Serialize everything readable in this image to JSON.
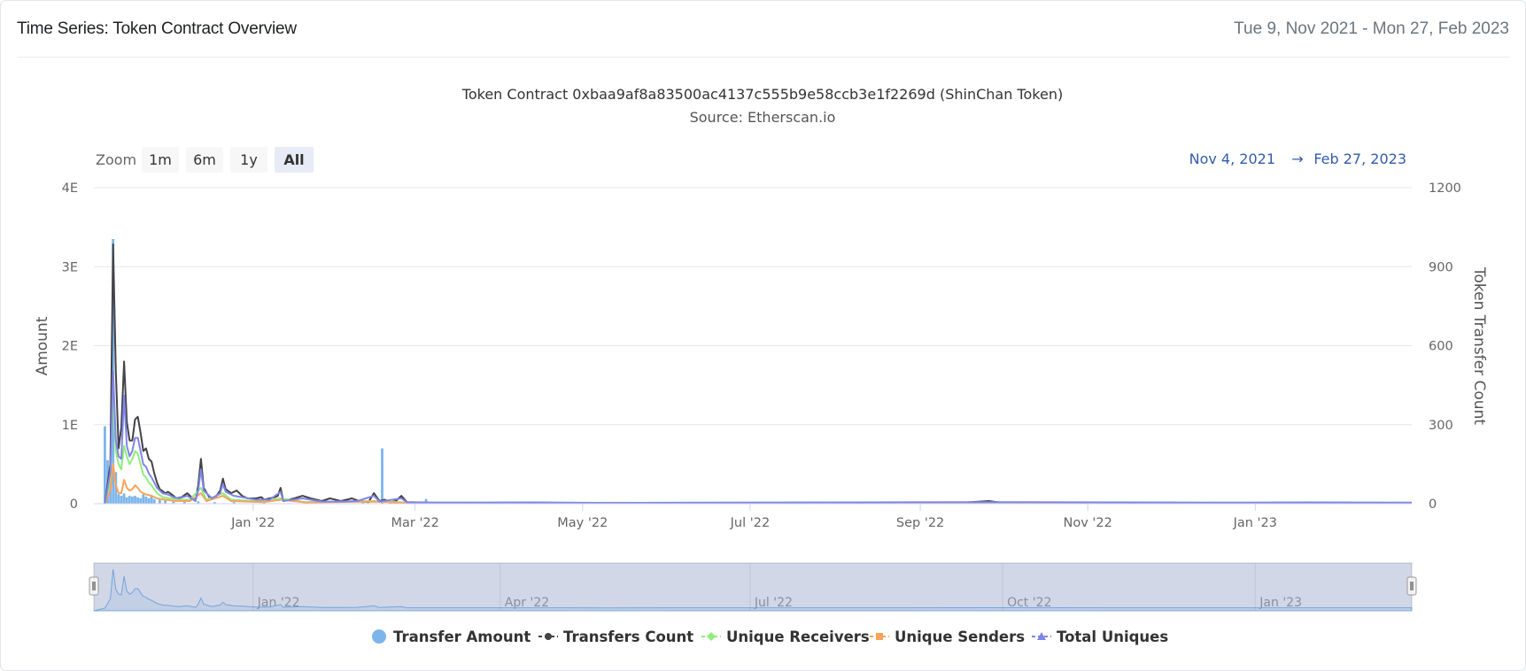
{
  "card": {
    "title": "Time Series: Token Contract Overview",
    "date_range": "Tue 9, Nov 2021 - Mon 27, Feb 2023"
  },
  "chart_data": {
    "type": "line",
    "title": "Token Contract 0xbaa9af8a83500ac4137c555b9e58ccb3e1f2269d (ShinChan Token)",
    "subtitle": "Source: Etherscan.io",
    "zoom": {
      "label": "Zoom",
      "buttons": [
        "1m",
        "6m",
        "1y",
        "All"
      ],
      "selected": "All"
    },
    "range_selector": {
      "from": "Nov 4, 2021",
      "arrow": "→",
      "to": "Feb 27, 2023"
    },
    "x_axis": {
      "type": "datetime",
      "range": [
        "2021-11-04",
        "2023-02-27"
      ],
      "ticks": [
        {
          "date": "2022-01-01",
          "label": "Jan '22"
        },
        {
          "date": "2022-03-01",
          "label": "Mar '22"
        },
        {
          "date": "2022-05-01",
          "label": "May '22"
        },
        {
          "date": "2022-07-01",
          "label": "Jul '22"
        },
        {
          "date": "2022-09-01",
          "label": "Sep '22"
        },
        {
          "date": "2022-11-01",
          "label": "Nov '22"
        },
        {
          "date": "2023-01-01",
          "label": "Jan '23"
        }
      ]
    },
    "y_left": {
      "label": "Amount",
      "ylim": [
        0,
        4
      ],
      "ticks": [
        {
          "value": 0,
          "label": "0"
        },
        {
          "value": 1,
          "label": "1E"
        },
        {
          "value": 2,
          "label": "2E"
        },
        {
          "value": 3,
          "label": "3E"
        },
        {
          "value": 4,
          "label": "4E"
        }
      ]
    },
    "y_right": {
      "label": "Token Transfer Count",
      "ylim": [
        0,
        1200
      ],
      "ticks": [
        0,
        300,
        600,
        900,
        1200
      ]
    },
    "navigator": {
      "ticks": [
        {
          "date": "2022-01-01",
          "label": "Jan '22"
        },
        {
          "date": "2022-04-01",
          "label": "Apr '22"
        },
        {
          "date": "2022-07-01",
          "label": "Jul '22"
        },
        {
          "date": "2022-10-01",
          "label": "Oct '22"
        },
        {
          "date": "2023-01-01",
          "label": "Jan '23"
        }
      ]
    },
    "grid": true,
    "legend_position": "bottom-center",
    "colors": {
      "transfer_amount": "#7cb5ec",
      "transfers_count": "#434348",
      "unique_receivers": "#90ed7d",
      "unique_senders": "#f7a35c",
      "total_uniques": "#8085e9"
    },
    "series": [
      {
        "name": "Transfer Amount",
        "key": "transfer_amount",
        "kind": "bar",
        "axis": "left",
        "points": [
          [
            "2021-11-08",
            0.98
          ],
          [
            "2021-11-09",
            0.55
          ],
          [
            "2021-11-10",
            0.35
          ],
          [
            "2021-11-11",
            3.35
          ],
          [
            "2021-11-12",
            0.4
          ],
          [
            "2021-11-13",
            0.12
          ],
          [
            "2021-11-14",
            0.1
          ],
          [
            "2021-11-15",
            0.13
          ],
          [
            "2021-11-16",
            0.08
          ],
          [
            "2021-11-17",
            0.1
          ],
          [
            "2021-11-18",
            0.09
          ],
          [
            "2021-11-19",
            0.1
          ],
          [
            "2021-11-20",
            0.08
          ],
          [
            "2021-11-21",
            0.07
          ],
          [
            "2021-11-22",
            0.12
          ],
          [
            "2021-11-23",
            0.09
          ],
          [
            "2021-11-24",
            0.07
          ],
          [
            "2021-11-25",
            0.11
          ],
          [
            "2021-11-26",
            0.06
          ],
          [
            "2021-11-28",
            0.05
          ],
          [
            "2021-11-30",
            0.04
          ],
          [
            "2021-12-03",
            0.03
          ],
          [
            "2021-12-07",
            0.03
          ],
          [
            "2021-12-12",
            0.03
          ],
          [
            "2021-12-18",
            0.02
          ],
          [
            "2021-12-25",
            0.02
          ],
          [
            "2022-01-05",
            0.02
          ],
          [
            "2022-01-20",
            0.02
          ],
          [
            "2022-02-10",
            0.02
          ],
          [
            "2022-02-17",
            0.7
          ],
          [
            "2022-03-05",
            0.06
          ],
          [
            "2022-03-20",
            0.02
          ]
        ]
      },
      {
        "name": "Transfers Count",
        "key": "transfers_count",
        "kind": "line",
        "axis": "right",
        "points": [
          [
            "2021-11-08",
            0
          ],
          [
            "2021-11-10",
            150
          ],
          [
            "2021-11-11",
            985
          ],
          [
            "2021-11-12",
            500
          ],
          [
            "2021-11-13",
            210
          ],
          [
            "2021-11-14",
            290
          ],
          [
            "2021-11-15",
            540
          ],
          [
            "2021-11-16",
            310
          ],
          [
            "2021-11-17",
            240
          ],
          [
            "2021-11-18",
            240
          ],
          [
            "2021-11-19",
            320
          ],
          [
            "2021-11-20",
            330
          ],
          [
            "2021-11-21",
            270
          ],
          [
            "2021-11-22",
            200
          ],
          [
            "2021-11-23",
            210
          ],
          [
            "2021-11-24",
            170
          ],
          [
            "2021-11-25",
            160
          ],
          [
            "2021-11-26",
            115
          ],
          [
            "2021-11-27",
            80
          ],
          [
            "2021-11-28",
            55
          ],
          [
            "2021-11-30",
            40
          ],
          [
            "2021-12-01",
            45
          ],
          [
            "2021-12-03",
            30
          ],
          [
            "2021-12-04",
            20
          ],
          [
            "2021-12-06",
            25
          ],
          [
            "2021-12-08",
            40
          ],
          [
            "2021-12-09",
            30
          ],
          [
            "2021-12-11",
            10
          ],
          [
            "2021-12-12",
            70
          ],
          [
            "2021-12-13",
            170
          ],
          [
            "2021-12-14",
            60
          ],
          [
            "2021-12-16",
            25
          ],
          [
            "2021-12-18",
            20
          ],
          [
            "2021-12-20",
            50
          ],
          [
            "2021-12-21",
            95
          ],
          [
            "2021-12-22",
            55
          ],
          [
            "2021-12-24",
            40
          ],
          [
            "2021-12-26",
            50
          ],
          [
            "2021-12-28",
            30
          ],
          [
            "2021-12-30",
            20
          ],
          [
            "2022-01-02",
            20
          ],
          [
            "2022-01-04",
            25
          ],
          [
            "2022-01-05",
            15
          ],
          [
            "2022-01-07",
            20
          ],
          [
            "2022-01-09",
            25
          ],
          [
            "2022-01-10",
            30
          ],
          [
            "2022-01-11",
            60
          ],
          [
            "2022-01-12",
            10
          ],
          [
            "2022-01-16",
            20
          ],
          [
            "2022-01-19",
            30
          ],
          [
            "2022-01-22",
            20
          ],
          [
            "2022-01-26",
            10
          ],
          [
            "2022-01-29",
            20
          ],
          [
            "2022-02-02",
            10
          ],
          [
            "2022-02-06",
            20
          ],
          [
            "2022-02-08",
            12
          ],
          [
            "2022-02-12",
            6
          ],
          [
            "2022-02-14",
            40
          ],
          [
            "2022-02-16",
            10
          ],
          [
            "2022-02-18",
            15
          ],
          [
            "2022-02-20",
            5
          ],
          [
            "2022-02-22",
            10
          ],
          [
            "2022-02-24",
            30
          ],
          [
            "2022-02-26",
            6
          ],
          [
            "2022-03-05",
            4
          ],
          [
            "2022-04-01",
            3
          ],
          [
            "2022-06-01",
            3
          ],
          [
            "2022-09-15",
            3
          ],
          [
            "2022-09-26",
            10
          ],
          [
            "2022-10-01",
            3
          ],
          [
            "2023-01-01",
            3
          ],
          [
            "2023-02-27",
            3
          ]
        ]
      },
      {
        "name": "Unique Receivers",
        "key": "unique_receivers",
        "kind": "line",
        "axis": "right",
        "points": [
          [
            "2021-11-08",
            0
          ],
          [
            "2021-11-10",
            90
          ],
          [
            "2021-11-11",
            430
          ],
          [
            "2021-11-12",
            200
          ],
          [
            "2021-11-13",
            150
          ],
          [
            "2021-11-14",
            130
          ],
          [
            "2021-11-15",
            220
          ],
          [
            "2021-11-16",
            180
          ],
          [
            "2021-11-17",
            150
          ],
          [
            "2021-11-18",
            170
          ],
          [
            "2021-11-19",
            200
          ],
          [
            "2021-11-20",
            190
          ],
          [
            "2021-11-21",
            150
          ],
          [
            "2021-11-22",
            110
          ],
          [
            "2021-11-23",
            100
          ],
          [
            "2021-11-24",
            80
          ],
          [
            "2021-11-25",
            70
          ],
          [
            "2021-11-27",
            40
          ],
          [
            "2021-11-29",
            25
          ],
          [
            "2021-12-02",
            20
          ],
          [
            "2021-12-05",
            15
          ],
          [
            "2021-12-09",
            15
          ],
          [
            "2021-12-13",
            60
          ],
          [
            "2021-12-15",
            15
          ],
          [
            "2021-12-21",
            40
          ],
          [
            "2021-12-24",
            15
          ],
          [
            "2022-01-05",
            8
          ],
          [
            "2022-01-11",
            20
          ],
          [
            "2022-01-20",
            6
          ],
          [
            "2022-02-14",
            10
          ],
          [
            "2022-03-01",
            3
          ],
          [
            "2023-02-27",
            2
          ]
        ]
      },
      {
        "name": "Unique Senders",
        "key": "unique_senders",
        "kind": "line",
        "axis": "right",
        "points": [
          [
            "2021-11-08",
            0
          ],
          [
            "2021-11-10",
            50
          ],
          [
            "2021-11-11",
            150
          ],
          [
            "2021-11-12",
            70
          ],
          [
            "2021-11-13",
            40
          ],
          [
            "2021-11-14",
            40
          ],
          [
            "2021-11-15",
            90
          ],
          [
            "2021-11-16",
            60
          ],
          [
            "2021-11-17",
            50
          ],
          [
            "2021-11-18",
            55
          ],
          [
            "2021-11-19",
            70
          ],
          [
            "2021-11-20",
            60
          ],
          [
            "2021-11-21",
            45
          ],
          [
            "2021-11-23",
            35
          ],
          [
            "2021-11-25",
            30
          ],
          [
            "2021-11-27",
            20
          ],
          [
            "2021-11-30",
            15
          ],
          [
            "2021-12-04",
            10
          ],
          [
            "2021-12-09",
            10
          ],
          [
            "2021-12-13",
            40
          ],
          [
            "2021-12-15",
            10
          ],
          [
            "2021-12-21",
            30
          ],
          [
            "2021-12-24",
            10
          ],
          [
            "2022-01-05",
            6
          ],
          [
            "2022-01-11",
            15
          ],
          [
            "2022-01-20",
            5
          ],
          [
            "2022-02-14",
            8
          ],
          [
            "2022-03-01",
            2
          ],
          [
            "2023-02-27",
            2
          ]
        ]
      },
      {
        "name": "Total Uniques",
        "key": "total_uniques",
        "kind": "line",
        "axis": "right",
        "points": [
          [
            "2021-11-08",
            0
          ],
          [
            "2021-11-10",
            120
          ],
          [
            "2021-11-11",
            500
          ],
          [
            "2021-11-12",
            240
          ],
          [
            "2021-11-13",
            180
          ],
          [
            "2021-11-14",
            170
          ],
          [
            "2021-11-15",
            410
          ],
          [
            "2021-11-16",
            220
          ],
          [
            "2021-11-17",
            180
          ],
          [
            "2021-11-18",
            200
          ],
          [
            "2021-11-19",
            250
          ],
          [
            "2021-11-20",
            250
          ],
          [
            "2021-11-21",
            200
          ],
          [
            "2021-11-22",
            150
          ],
          [
            "2021-11-23",
            140
          ],
          [
            "2021-11-24",
            115
          ],
          [
            "2021-11-25",
            100
          ],
          [
            "2021-11-26",
            80
          ],
          [
            "2021-11-27",
            60
          ],
          [
            "2021-11-29",
            40
          ],
          [
            "2021-12-01",
            35
          ],
          [
            "2021-12-03",
            25
          ],
          [
            "2021-12-05",
            20
          ],
          [
            "2021-12-08",
            30
          ],
          [
            "2021-12-11",
            10
          ],
          [
            "2021-12-12",
            50
          ],
          [
            "2021-12-13",
            130
          ],
          [
            "2021-12-14",
            50
          ],
          [
            "2021-12-17",
            20
          ],
          [
            "2021-12-20",
            40
          ],
          [
            "2021-12-21",
            75
          ],
          [
            "2021-12-22",
            45
          ],
          [
            "2021-12-25",
            30
          ],
          [
            "2021-12-28",
            25
          ],
          [
            "2022-01-02",
            15
          ],
          [
            "2022-01-07",
            15
          ],
          [
            "2022-01-11",
            45
          ],
          [
            "2022-01-12",
            10
          ],
          [
            "2022-01-19",
            20
          ],
          [
            "2022-01-26",
            8
          ],
          [
            "2022-02-02",
            8
          ],
          [
            "2022-02-08",
            10
          ],
          [
            "2022-02-14",
            30
          ],
          [
            "2022-02-16",
            8
          ],
          [
            "2022-02-24",
            20
          ],
          [
            "2022-02-26",
            5
          ],
          [
            "2022-03-10",
            4
          ],
          [
            "2022-04-15",
            5
          ],
          [
            "2022-05-10",
            3
          ],
          [
            "2022-06-20",
            4
          ],
          [
            "2022-08-15",
            5
          ],
          [
            "2022-09-26",
            6
          ],
          [
            "2022-11-10",
            5
          ],
          [
            "2022-12-20",
            4
          ],
          [
            "2023-01-20",
            5
          ],
          [
            "2023-02-27",
            4
          ]
        ]
      }
    ]
  }
}
